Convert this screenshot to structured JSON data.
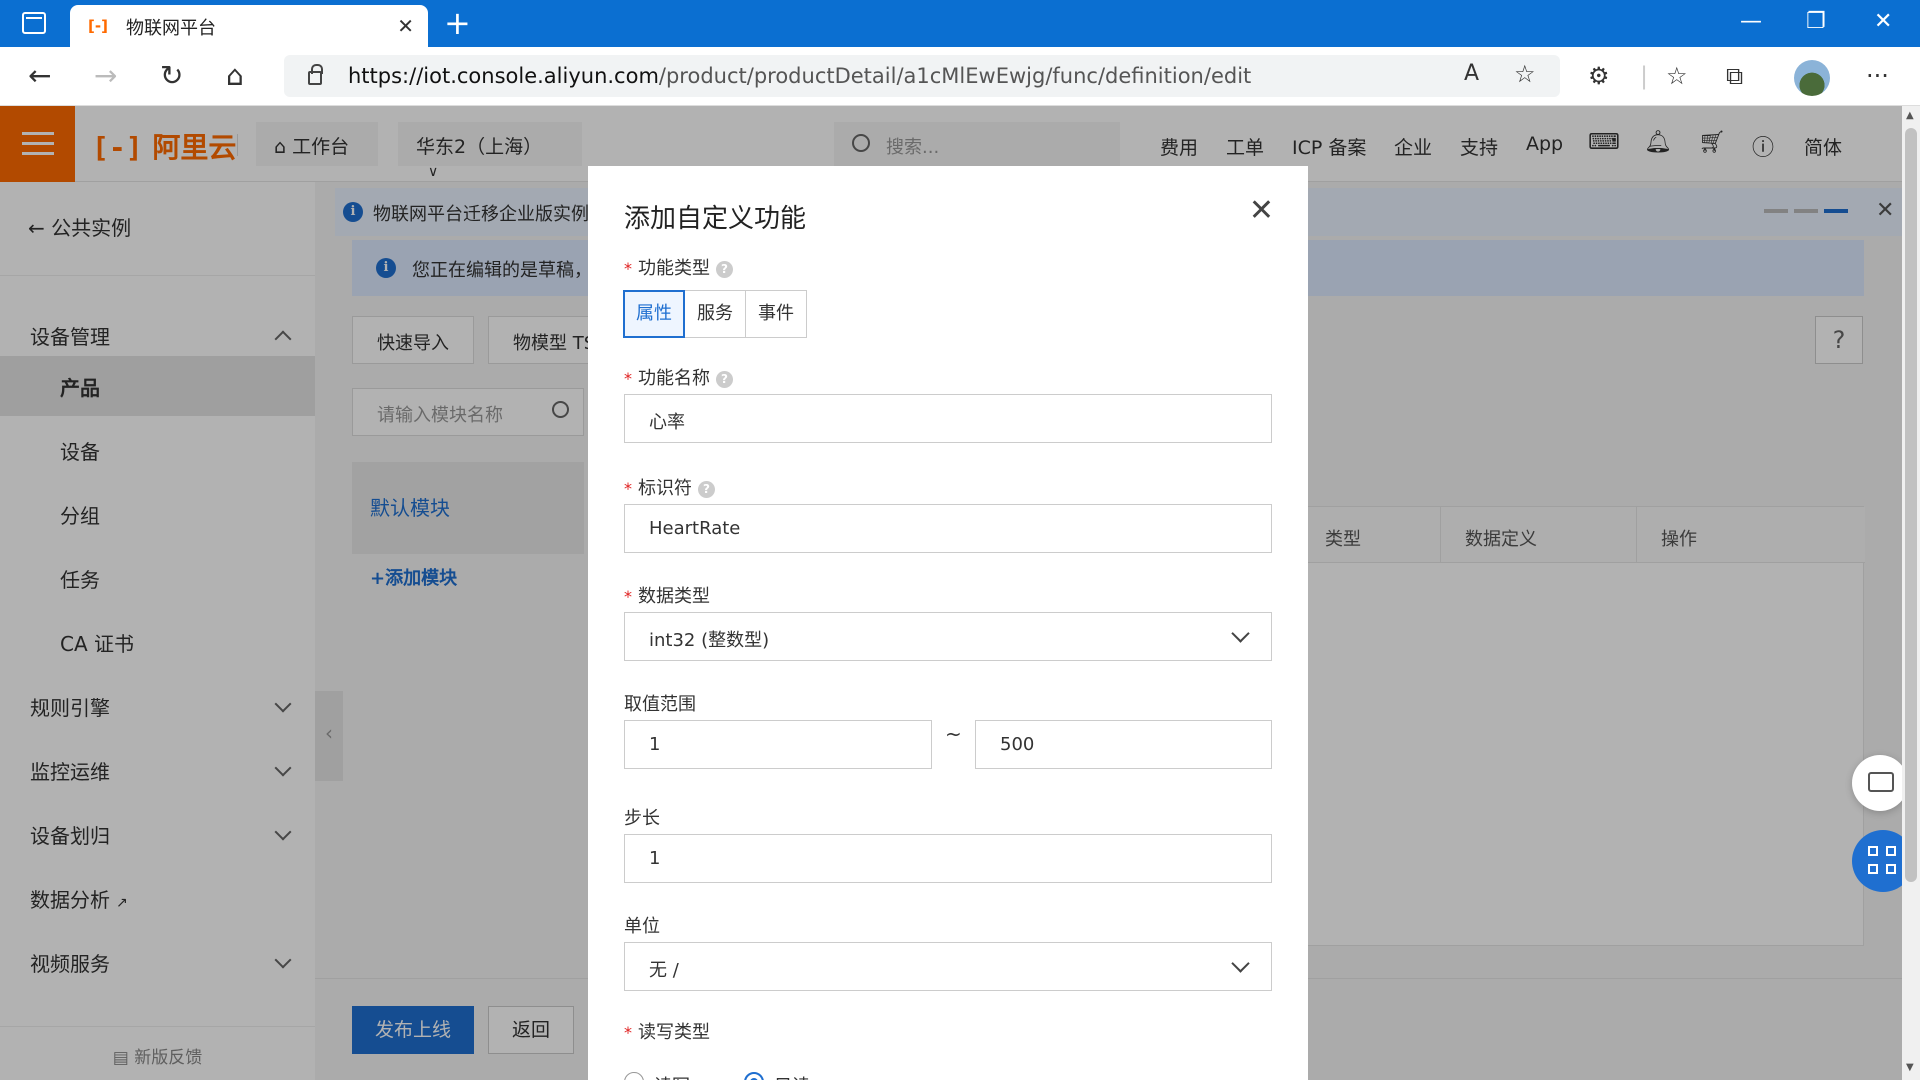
{
  "browser": {
    "tab_title": "物联网平台",
    "url_host": "https://iot.console.aliyun.com",
    "url_path": "/product/productDetail/a1cMlEwEwjg/func/definition/edit",
    "read_aloud": "A",
    "more": "···"
  },
  "header": {
    "logo_text": "阿里云",
    "workbench": "工作台",
    "region": "华东2（上海）",
    "search_placeholder": "搜索...",
    "links": [
      "费用",
      "工单",
      "ICP 备案",
      "企业",
      "支持",
      "App"
    ],
    "lang": "简体"
  },
  "sidebar": {
    "back_label": "公共实例",
    "items": [
      {
        "label": "设备管理"
      },
      {
        "label": "产品"
      },
      {
        "label": "设备"
      },
      {
        "label": "分组"
      },
      {
        "label": "任务"
      },
      {
        "label": "CA 证书"
      },
      {
        "label": "规则引擎"
      },
      {
        "label": "监控运维"
      },
      {
        "label": "设备划归"
      },
      {
        "label": "数据分析"
      },
      {
        "label": "视频服务"
      }
    ],
    "feedback": "新版反馈"
  },
  "main": {
    "notice1": "物联网平台迁移企业版实例",
    "notice2": "您正在编辑的是草稿，",
    "quick_import": "快速导入",
    "tsl": "物模型 TS",
    "module_search_placeholder": "请输入模块名称",
    "default_module": "默认模块",
    "add_module": "+添加模块",
    "table_headers": [
      "类型",
      "数据定义",
      "操作"
    ],
    "help": "?",
    "publish": "发布上线",
    "return": "返回"
  },
  "modal": {
    "title": "添加自定义功能",
    "func_type_label": "功能类型",
    "func_types": [
      "属性",
      "服务",
      "事件"
    ],
    "func_name_label": "功能名称",
    "func_name_value": "心率",
    "identifier_label": "标识符",
    "identifier_value": "HeartRate",
    "data_type_label": "数据类型",
    "data_type_value": "int32 (整数型)",
    "range_label": "取值范围",
    "range_min": "1",
    "range_tilde": "~",
    "range_max": "500",
    "step_label": "步长",
    "step_value": "1",
    "unit_label": "单位",
    "unit_value": "无 /",
    "rw_label": "读写类型",
    "rw_options": [
      "读写",
      "只读"
    ],
    "rw_selected": "只读"
  }
}
